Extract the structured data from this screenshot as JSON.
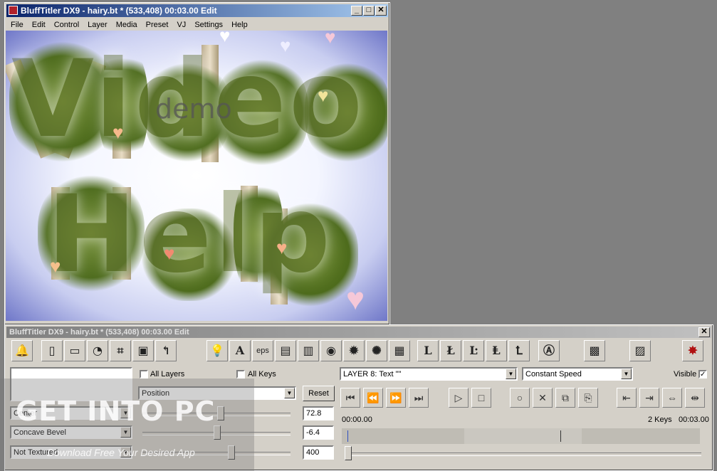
{
  "main_window": {
    "title": "BluffTitler DX9 - hairy.bt * (533,408) 00:03.00 Edit",
    "menu": [
      "File",
      "Edit",
      "Control",
      "Layer",
      "Media",
      "Preset",
      "VJ",
      "Settings",
      "Help"
    ],
    "scene": {
      "word1": "Video",
      "word2": "Help",
      "demo_text": "demo"
    }
  },
  "control_panel": {
    "title": "BluffTitler DX9 - hairy.bt * (533,408) 00:03.00 Edit",
    "toolbar_icons": [
      "bell-icon",
      "new-file-icon",
      "open-folder-icon",
      "refresh-icon",
      "crop-icon",
      "save-icon",
      "undo-icon",
      "lightbulb-icon",
      "text-a-icon",
      "eps-icon",
      "camera-icon",
      "video-camera-icon",
      "sphere-icon",
      "splat-icon",
      "particles-icon",
      "piano-icon",
      "layer-l-icon",
      "layer-l-spark-icon",
      "layer-l-plain-icon",
      "layer-l-delete-icon",
      "layer-l-copy-icon",
      "text-layer-icon",
      "checker-icon",
      "export-icon",
      "splat-red-icon"
    ],
    "eps_label": "eps",
    "all_layers_label": "All Layers",
    "all_layers_checked": false,
    "all_keys_label": "All Keys",
    "all_keys_checked": false,
    "layer_select": "LAYER 8: Text \"\"",
    "speed_select": "Constant Speed",
    "visible_label": "Visible",
    "visible_checked": true,
    "property_select": "Position",
    "reset_label": "Reset",
    "align_select": "Center",
    "bevel_select": "Concave Bevel",
    "texture_select": "Not Textured",
    "values": [
      "72.8",
      "-6.4",
      "400"
    ],
    "time_start": "00:00.00",
    "keys_count": "2 Keys",
    "time_end": "00:03.00"
  },
  "watermark": {
    "main": "GET INTO PC",
    "sub": "Download Free Your Desired App"
  }
}
